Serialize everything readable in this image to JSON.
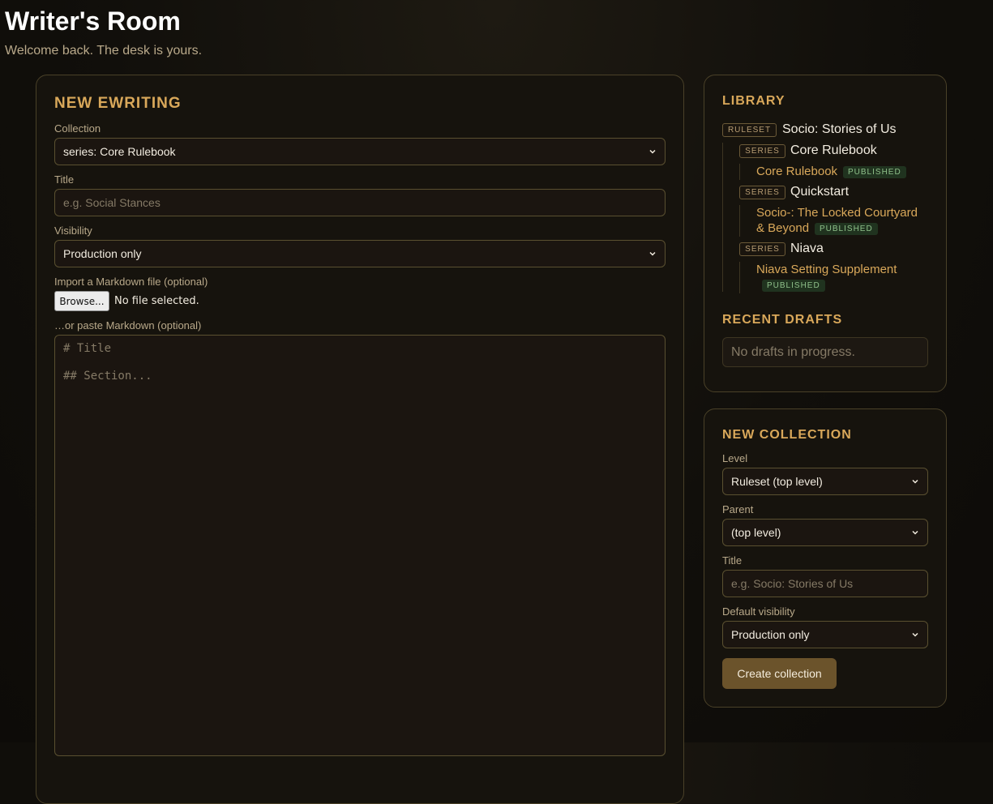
{
  "header": {
    "title": "Writer's Room",
    "subtitle": "Welcome back. The desk is yours."
  },
  "new_writing": {
    "heading": "NEW EWRITING",
    "collection_label": "Collection",
    "collection_value": "series: Core Rulebook",
    "title_label": "Title",
    "title_placeholder": "e.g. Social Stances",
    "visibility_label": "Visibility",
    "visibility_value": "Production only",
    "import_label": "Import a Markdown file (optional)",
    "browse_label": "Browse...",
    "file_status": "No file selected.",
    "paste_label": "…or paste Markdown (optional)",
    "markdown_placeholder": [
      "# Title",
      "## Section..."
    ]
  },
  "library": {
    "heading": "LIBRARY",
    "ruleset": {
      "badge": "RULESET",
      "title": "Socio: Stories of Us"
    },
    "series": [
      {
        "badge": "SERIES",
        "title": "Core Rulebook",
        "docs": [
          {
            "title": "Core Rulebook",
            "status": "PUBLISHED"
          }
        ]
      },
      {
        "badge": "SERIES",
        "title": "Quickstart",
        "docs": [
          {
            "title_line1": "Socio-: The Locked Courtyard",
            "title_line2": "& Beyond",
            "status": "PUBLISHED"
          }
        ]
      },
      {
        "badge": "SERIES",
        "title": "Niava",
        "docs": [
          {
            "title": "Niava Setting Supplement",
            "status": "PUBLISHED"
          }
        ]
      }
    ]
  },
  "recent_drafts": {
    "heading": "RECENT DRAFTS",
    "empty": "No drafts in progress."
  },
  "new_collection": {
    "heading": "NEW COLLECTION",
    "level_label": "Level",
    "level_value": "Ruleset (top level)",
    "parent_label": "Parent",
    "parent_value": "(top level)",
    "title_label": "Title",
    "title_placeholder": "e.g. Socio: Stories of Us",
    "visibility_label": "Default visibility",
    "visibility_value": "Production only",
    "create_label": "Create collection"
  },
  "icons": {
    "select_caret": "chevron-down-icon"
  },
  "colors": {
    "accent": "#d9a85a",
    "published_bg": "#20331f",
    "published_text": "#8fc08a",
    "button_bg": "#6b532b"
  }
}
